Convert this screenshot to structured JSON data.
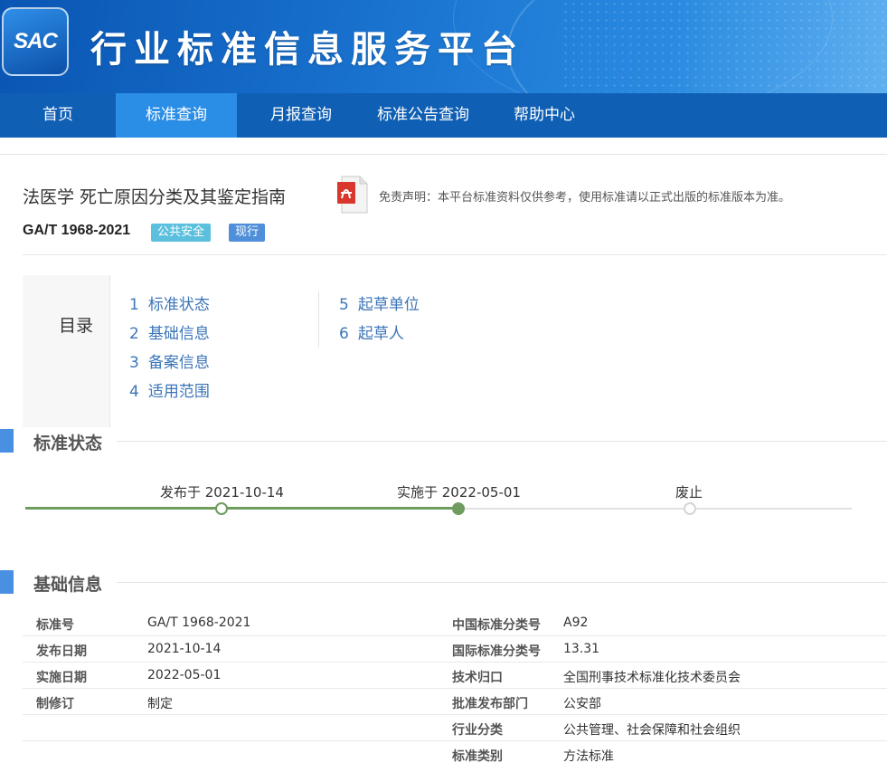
{
  "header": {
    "logo_text": "SAC",
    "site_title": "行业标准信息服务平台"
  },
  "nav": {
    "items": [
      {
        "label": "首页"
      },
      {
        "label": "标准查询"
      },
      {
        "label": "月报查询"
      },
      {
        "label": "标准公告查询"
      },
      {
        "label": "帮助中心"
      }
    ],
    "active_index": 1
  },
  "document": {
    "title": "法医学 死亡原因分类及其鉴定指南",
    "code": "GA/T 1968-2021",
    "category_badge": "公共安全",
    "status_badge": "现行",
    "disclaimer": "免责声明：本平台标准资料仅供参考，使用标准请以正式出版的标准版本为准。",
    "pdf_icon": "pdf-file-icon"
  },
  "toc": {
    "label": "目录",
    "items": [
      {
        "num": "1",
        "label": "标准状态"
      },
      {
        "num": "2",
        "label": "基础信息"
      },
      {
        "num": "3",
        "label": "备案信息"
      },
      {
        "num": "4",
        "label": "适用范围"
      },
      {
        "num": "5",
        "label": "起草单位"
      },
      {
        "num": "6",
        "label": "起草人"
      }
    ]
  },
  "status_section": {
    "title": "标准状态",
    "timeline": [
      {
        "label": "发布于 2021-10-14",
        "state": "done"
      },
      {
        "label": "实施于 2022-05-01",
        "state": "current"
      },
      {
        "label": "废止",
        "state": "pending"
      }
    ],
    "progress_color": "#6e9d5e"
  },
  "basic_section": {
    "title": "基础信息",
    "rows": [
      {
        "k1": "标准号",
        "v1": "GA/T 1968-2021",
        "k2": "中国标准分类号",
        "v2": "A92"
      },
      {
        "k1": "发布日期",
        "v1": "2021-10-14",
        "k2": "国际标准分类号",
        "v2": "13.31"
      },
      {
        "k1": "实施日期",
        "v1": "2022-05-01",
        "k2": "技术归口",
        "v2": "全国刑事技术标准化技术委员会"
      },
      {
        "k1": "制修订",
        "v1": "制定",
        "k2": "批准发布部门",
        "v2": "公安部"
      },
      {
        "k1": "",
        "v1": "",
        "k2": "行业分类",
        "v2": "公共管理、社会保障和社会组织"
      },
      {
        "k1": "",
        "v1": "",
        "k2": "标准类别",
        "v2": "方法标准"
      }
    ]
  },
  "colors": {
    "nav_bg": "#0f5fb4",
    "nav_active": "#2b8ee6",
    "accent": "#4a90e2",
    "link": "#3c76b8"
  }
}
